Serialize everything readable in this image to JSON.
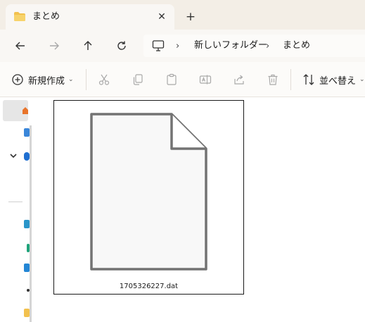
{
  "tab": {
    "title": "まとめ",
    "folder_icon": "folder-icon",
    "close_glyph": "✕",
    "new_tab_glyph": "+"
  },
  "nav": {
    "back_icon": "arrow-left-icon",
    "forward_icon": "arrow-right-icon",
    "up_icon": "arrow-up-icon",
    "refresh_icon": "refresh-icon",
    "breadcrumb": [
      {
        "icon": "computer-icon"
      },
      {
        "label": "新しいフォルダー"
      },
      {
        "label": "まとめ"
      }
    ],
    "separator": "›"
  },
  "toolbar": {
    "new_label": "新規作成",
    "sort_label": "並べ替え",
    "caret": "⌄",
    "icons": [
      "cut-icon",
      "copy-icon",
      "paste-icon",
      "rename-icon",
      "share-icon",
      "delete-icon"
    ]
  },
  "files": [
    {
      "name": "1705326227.dat",
      "icon": "file-icon"
    }
  ],
  "colors": {
    "titlebar": "#f3eee6",
    "tab": "#f9f7f4",
    "toolbar": "#fcfbf9",
    "folder": "#f2c14e",
    "disabled_icon": "#a9a9a9"
  }
}
